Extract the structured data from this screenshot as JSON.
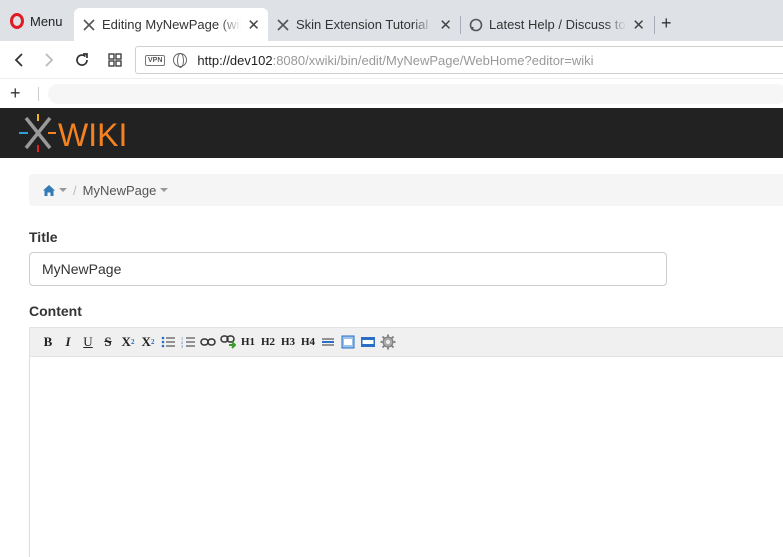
{
  "browser": {
    "menu_label": "Menu",
    "tabs": [
      {
        "title": "Editing MyNewPage (wiki",
        "icon": "xwiki-icon"
      },
      {
        "title": "Skin Extension Tutorial (XW",
        "icon": "xwiki-icon"
      },
      {
        "title": "Latest Help / Discuss topic",
        "icon": "discourse-icon"
      }
    ],
    "url_host": "http://dev102",
    "url_rest": ":8080/xwiki/bin/edit/MyNewPage/WebHome?editor=wiki",
    "vpn_label": "VPN"
  },
  "xwiki": {
    "logo_text": "WIKI",
    "brand_color": "#f58220"
  },
  "breadcrumb": {
    "page": "MyNewPage"
  },
  "form": {
    "title_label": "Title",
    "title_value": "MyNewPage",
    "content_label": "Content"
  },
  "toolbar": {
    "bold": "B",
    "italic": "I",
    "underline": "U",
    "strike": "S",
    "subscript": "X",
    "superscript": "X",
    "h1": "H1",
    "h2": "H2",
    "h3": "H3",
    "h4": "H4"
  }
}
